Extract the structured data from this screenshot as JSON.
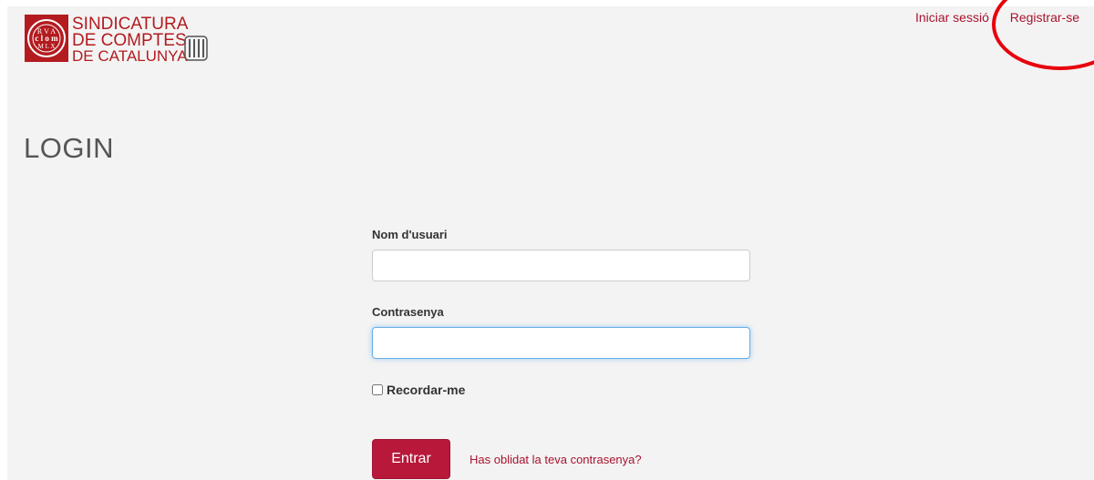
{
  "logo": {
    "line1": "SINDICATURA",
    "line2": "DE COMPTES",
    "line3": "DE CATALUNYA"
  },
  "nav": {
    "login_label": "Iniciar sessió",
    "register_label": "Registrar-se"
  },
  "page": {
    "title": "LOGIN"
  },
  "form": {
    "username_label": "Nom d'usuari",
    "username_value": "",
    "password_label": "Contrasenya",
    "password_value": "",
    "remember_label": "Recordar-me",
    "remember_checked": false,
    "submit_label": "Entrar",
    "forgot_label": "Has oblidat la teva contrasenya?"
  },
  "colors": {
    "brand": "#b8183a",
    "link": "#a8142f",
    "annotation": "#e8000d",
    "background": "#f3f3f3"
  }
}
